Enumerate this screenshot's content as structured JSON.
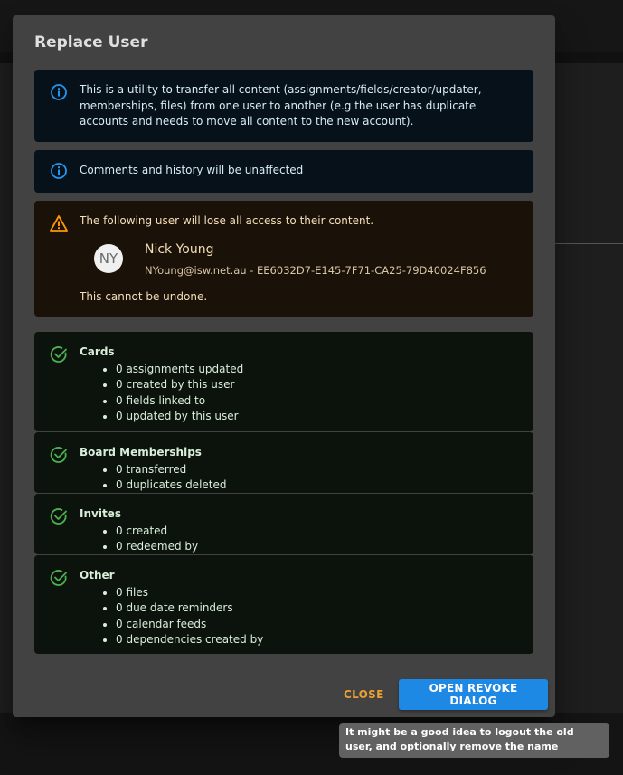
{
  "dialog": {
    "title": "Replace User",
    "info_1": "This is a utility to transfer all content (assignments/fields/creator/updater, memberships, files) from one user to another (e.g the user has duplicate accounts and needs to move all content to the new account).",
    "info_2": "Comments and history will be unaffected",
    "warning": {
      "line1": "The following user will lose all access to their content.",
      "avatar_initials": "NY",
      "user_name": "Nick Young",
      "user_detail": "NYoung@isw.net.au - EE6032D7-E145-7F71-CA25-79D40024F856",
      "line3": "This cannot be undone."
    },
    "sections": [
      {
        "heading": "Cards",
        "items": [
          "0 assignments updated",
          "0 created by this user",
          "0 fields linked to",
          "0 updated by this user"
        ]
      },
      {
        "heading": "Board Memberships",
        "items": [
          "0 transferred",
          "0 duplicates deleted"
        ]
      },
      {
        "heading": "Invites",
        "items": [
          "0 created",
          "0 redeemed by"
        ]
      },
      {
        "heading": "Other",
        "items": [
          "0 files",
          "0 due date reminders",
          "0 calendar feeds",
          "0 dependencies created by"
        ]
      }
    ],
    "actions": {
      "close_label": "CLOSE",
      "revoke_label": "OPEN REVOKE DIALOG"
    }
  },
  "tooltip": {
    "text": "It might be a good idea to logout the old user, and optionally remove the name"
  },
  "colors": {
    "info": "#2196f3",
    "warning": "#ff9800",
    "success": "#4caf50",
    "primary": "#1e88e5",
    "close": "#e9a032"
  },
  "icons": {
    "info": "info-circle-icon",
    "warning": "warning-triangle-icon",
    "success": "check-circle-icon"
  }
}
